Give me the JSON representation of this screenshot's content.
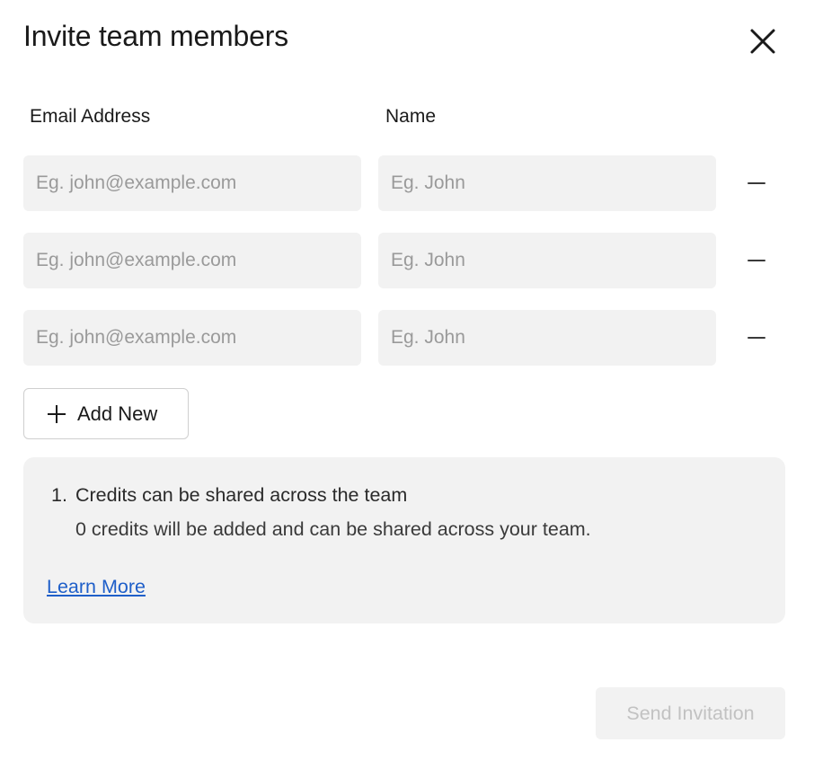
{
  "dialog": {
    "title": "Invite team members",
    "close_icon": "close-icon"
  },
  "columns": {
    "email": "Email Address",
    "name": "Name"
  },
  "rows": [
    {
      "email_value": "",
      "email_placeholder": "Eg. john@example.com",
      "name_value": "",
      "name_placeholder": "Eg. John",
      "remove_icon": "minus-icon"
    },
    {
      "email_value": "",
      "email_placeholder": "Eg. john@example.com",
      "name_value": "",
      "name_placeholder": "Eg. John",
      "remove_icon": "minus-icon"
    },
    {
      "email_value": "",
      "email_placeholder": "Eg. john@example.com",
      "name_value": "",
      "name_placeholder": "Eg. John",
      "remove_icon": "minus-icon"
    }
  ],
  "add_button": {
    "label": "Add New",
    "icon": "plus-icon"
  },
  "info": {
    "items": [
      {
        "number": "1.",
        "title": "Credits can be shared across the team",
        "description": "0 credits will be added and can be shared across your team."
      }
    ],
    "link_label": "Learn More",
    "link_color": "#1f5fc9"
  },
  "footer": {
    "send_label": "Send Invitation",
    "send_enabled": false
  }
}
